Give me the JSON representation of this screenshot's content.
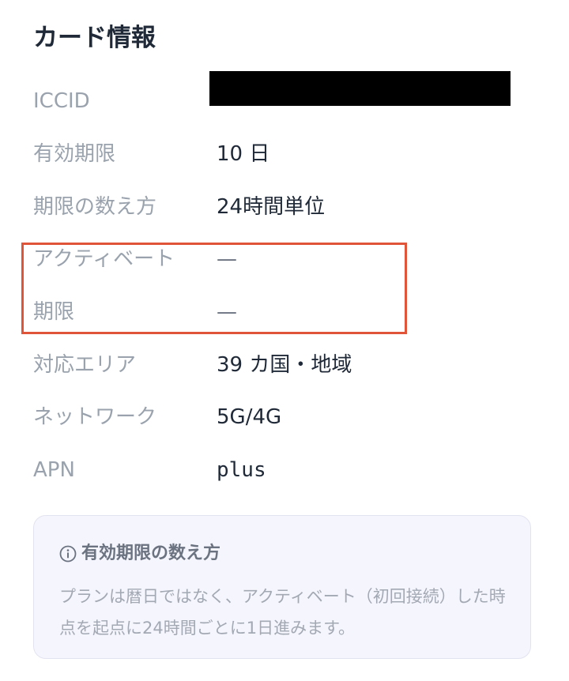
{
  "card_info": {
    "title": "カード情報",
    "rows": [
      {
        "label": "ICCID",
        "value": ""
      },
      {
        "label": "有効期限",
        "value": "10 日"
      },
      {
        "label": "期限の数え方",
        "value": "24時間単位"
      },
      {
        "label": "アクティベート",
        "value": "—"
      },
      {
        "label": "期限",
        "value": "—"
      },
      {
        "label": "対応エリア",
        "value": "39 カ国・地域"
      },
      {
        "label": "ネットワーク",
        "value": "5G/4G"
      },
      {
        "label": "APN",
        "value": "plus"
      }
    ]
  },
  "info_note": {
    "icon": "info-icon",
    "title": "有効期限の数え方",
    "body": "プランは暦日ではなく、アクティベート（初回接続）した時点を起点に24時間ごとに1日進みます。"
  },
  "colors": {
    "highlight_border": "#e0553a",
    "info_background": "#f5f5fd"
  }
}
